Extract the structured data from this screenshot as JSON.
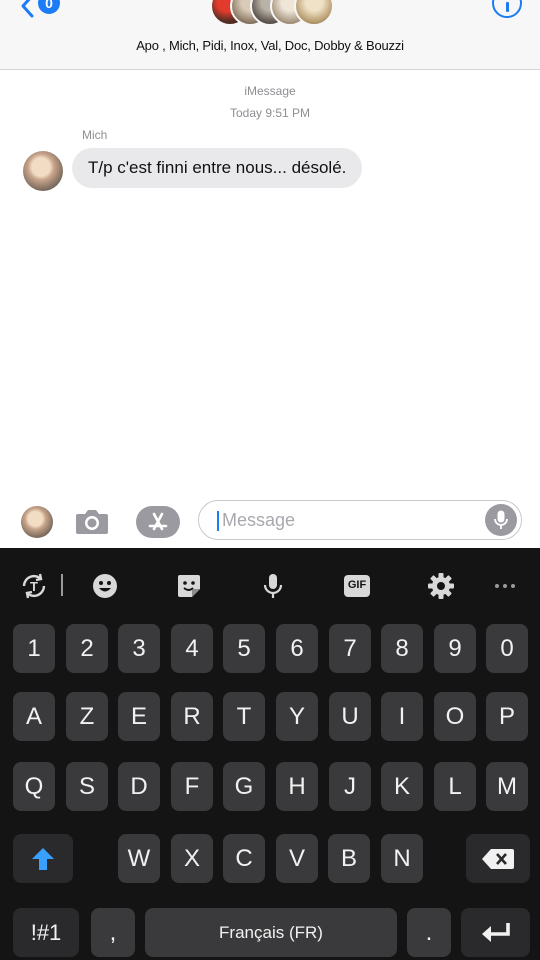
{
  "header": {
    "back_badge": "0",
    "group_names": "Apo , Mich, Pidi, Inox, Val, Doc, Dobby & Bouzzi"
  },
  "conversation": {
    "service": "iMessage",
    "timestamp": "Today 9:51 PM",
    "messages": [
      {
        "sender": "Mich",
        "text": "T/p c'est finni entre nous... désolé."
      }
    ]
  },
  "compose": {
    "placeholder": "Message"
  },
  "keyboard": {
    "toolbar": [
      "text-translate-icon",
      "emoji-icon",
      "sticker-icon",
      "mic-icon",
      "gif-icon",
      "settings-icon",
      "more-icon"
    ],
    "gif_label": "GIF",
    "rows": [
      [
        "1",
        "2",
        "3",
        "4",
        "5",
        "6",
        "7",
        "8",
        "9",
        "0"
      ],
      [
        "A",
        "Z",
        "E",
        "R",
        "T",
        "Y",
        "U",
        "I",
        "O",
        "P"
      ],
      [
        "Q",
        "S",
        "D",
        "F",
        "G",
        "H",
        "J",
        "K",
        "L",
        "M"
      ],
      [
        "W",
        "X",
        "C",
        "V",
        "B",
        "N"
      ]
    ],
    "symbols_label": "!#1",
    "comma_label": ",",
    "space_label": "Français (FR)",
    "period_label": "."
  },
  "colors": {
    "accent": "#1b7cf5",
    "bubble": "#e9e9eb",
    "keyboard_bg": "#141414",
    "key_bg": "#3a3a3c"
  }
}
